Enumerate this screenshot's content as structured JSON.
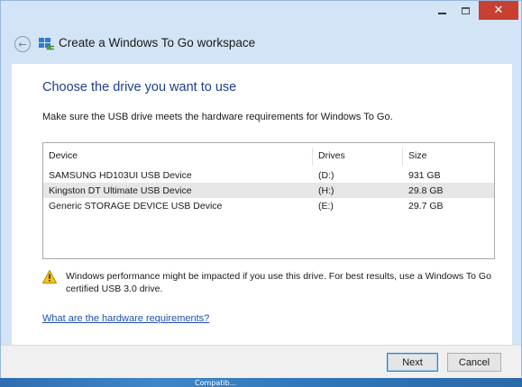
{
  "window": {
    "title": "Create a Windows To Go workspace",
    "controls": {
      "minimize_icon": "minimize-icon",
      "maximize_icon": "maximize-icon",
      "close_glyph": "✕"
    }
  },
  "header": {
    "back_icon": "back-arrow-icon",
    "back_glyph": "←",
    "app_icon": "windows-to-go-icon"
  },
  "content": {
    "heading": "Choose the drive you want to use",
    "instruction": "Make sure the USB drive meets the hardware requirements for Windows To Go.",
    "table": {
      "columns": [
        "Device",
        "Drives",
        "Size"
      ],
      "rows": [
        {
          "device": "SAMSUNG HD103UI USB Device",
          "drive": "(D:)",
          "size": "931 GB",
          "selected": false
        },
        {
          "device": "Kingston DT Ultimate USB Device",
          "drive": "(H:)",
          "size": "29.8 GB",
          "selected": true
        },
        {
          "device": "Generic STORAGE DEVICE USB Device",
          "drive": "(E:)",
          "size": "29.7 GB",
          "selected": false
        }
      ]
    },
    "warning": {
      "icon": "warning-icon",
      "text": "Windows performance might be impacted if you use this drive. For best results, use a Windows To Go certified USB 3.0 drive."
    },
    "link": "What are the hardware requirements?"
  },
  "footer": {
    "next_label": "Next",
    "cancel_label": "Cancel"
  },
  "desktop": {
    "partial_text": "Compatib..."
  },
  "colors": {
    "heading": "#1e3f8a",
    "link": "#1e4fb0",
    "close_button": "#c84031",
    "frame": "#d2e4f5",
    "selected_row": "#e6e6e6"
  }
}
